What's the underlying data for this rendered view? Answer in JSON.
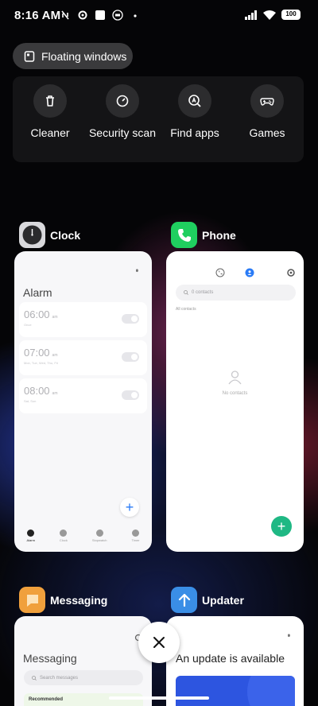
{
  "status_bar": {
    "time": "8:16 AM",
    "battery": "100"
  },
  "floating_windows": {
    "label": "Floating windows"
  },
  "quick_actions": [
    {
      "label": "Cleaner",
      "icon": "trash-icon"
    },
    {
      "label": "Security scan",
      "icon": "gauge-icon"
    },
    {
      "label": "Find apps",
      "icon": "search-app-icon"
    },
    {
      "label": "Games",
      "icon": "gamepad-icon"
    }
  ],
  "apps": {
    "clock": {
      "name": "Clock",
      "screen_title": "Alarm",
      "alarms": [
        {
          "time": "06:00",
          "period": "am",
          "sub": "Once"
        },
        {
          "time": "07:00",
          "period": "am",
          "sub": "Mon, Tue, Wed, Thu, Fri"
        },
        {
          "time": "08:00",
          "period": "am",
          "sub": "Sat, Sun"
        }
      ],
      "tabs": [
        "Alarm",
        "Clock",
        "Stopwatch",
        "Timer"
      ]
    },
    "phone": {
      "name": "Phone",
      "search_placeholder": "0 contacts",
      "all_contacts": "All contacts",
      "empty_text": "No contacts"
    },
    "messaging": {
      "name": "Messaging",
      "screen_title": "Messaging",
      "search_placeholder": "Search messages",
      "recommended": "Recommended"
    },
    "updater": {
      "name": "Updater",
      "screen_title": "An update is available"
    }
  },
  "colors": {
    "clock_icon_bg": "#d9d9dc",
    "phone_icon_bg": "#1fcf5f",
    "messaging_icon_bg": "#f0a03c",
    "updater_icon_bg": "#3a8ee6",
    "accent_blue": "#2a7bf6",
    "phone_fab": "#1fb884"
  }
}
